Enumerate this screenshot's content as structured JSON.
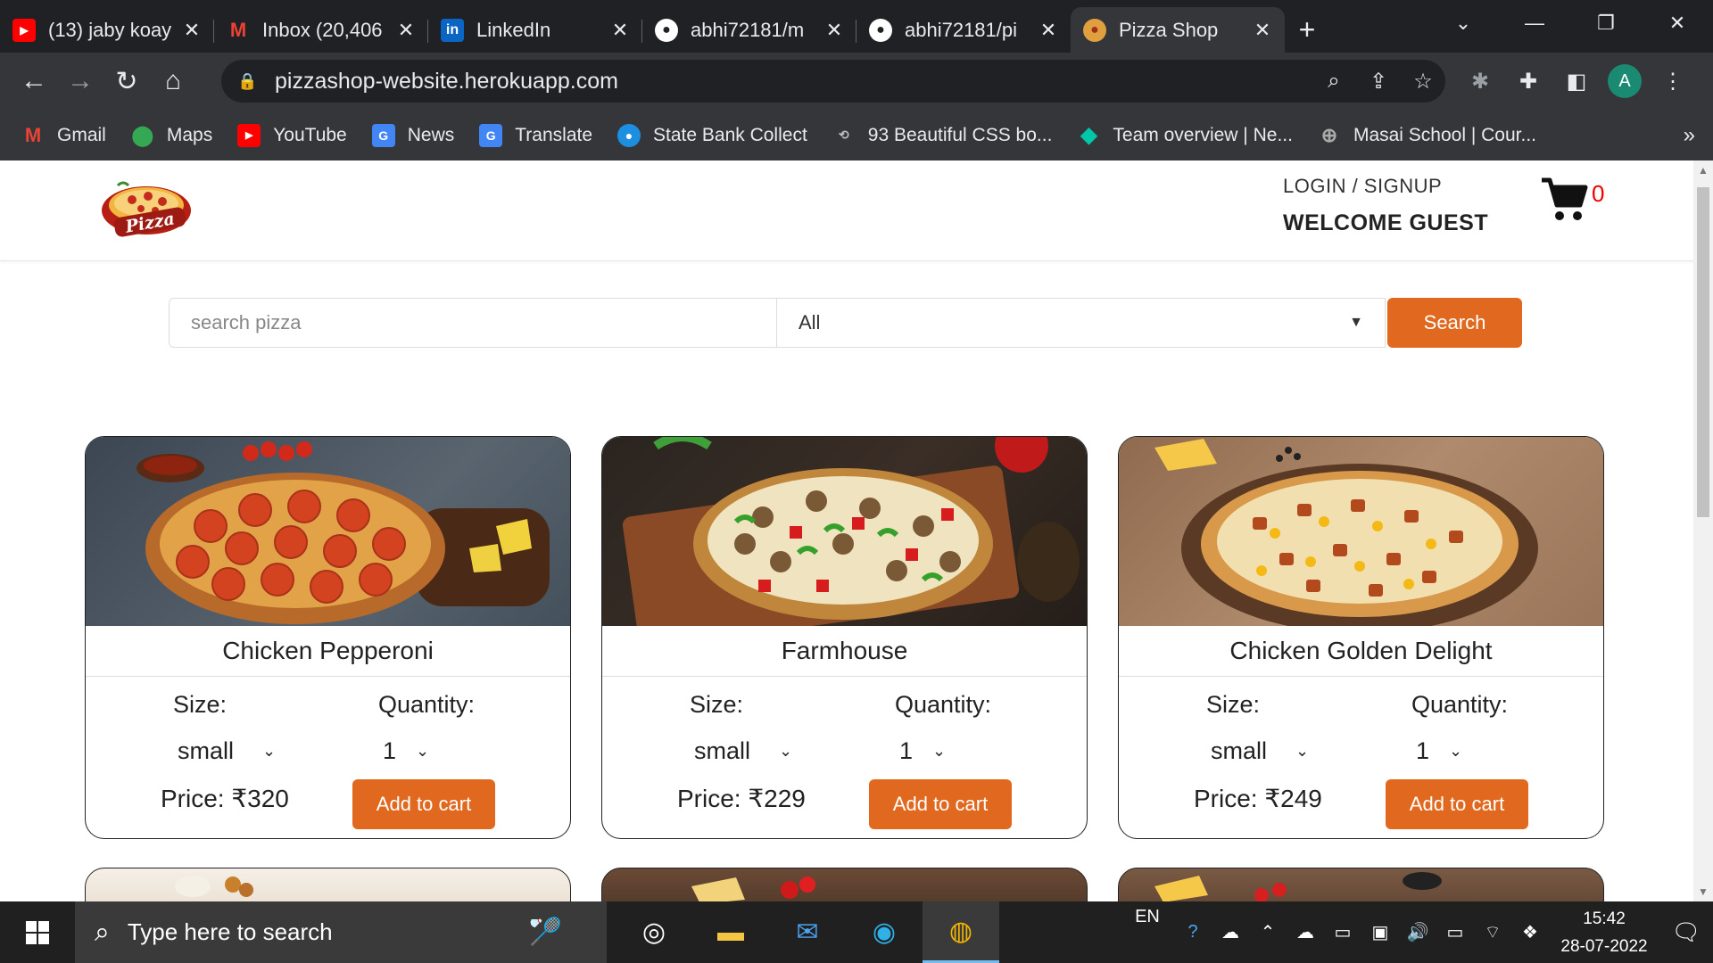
{
  "browser": {
    "tabs": [
      {
        "title": "(13) jaby koay",
        "icon": "youtube-icon",
        "color": "#ff0000"
      },
      {
        "title": "Inbox (20,406",
        "icon": "gmail-icon",
        "color": "#ea4335"
      },
      {
        "title": "LinkedIn",
        "icon": "linkedin-icon",
        "color": "#0a66c2"
      },
      {
        "title": "abhi72181/m",
        "icon": "github-icon",
        "color": "#ffffff"
      },
      {
        "title": "abhi72181/pi",
        "icon": "github-icon",
        "color": "#ffffff"
      },
      {
        "title": "Pizza Shop",
        "icon": "pizza-icon",
        "color": "#e0691f"
      }
    ],
    "url": "pizzashop-website.herokuapp.com",
    "profile_initial": "A",
    "bookmarks": [
      {
        "label": "Gmail",
        "icon": "gmail-icon",
        "color": "#ea4335"
      },
      {
        "label": "Maps",
        "icon": "maps-icon",
        "color": "#34a853"
      },
      {
        "label": "YouTube",
        "icon": "youtube-icon",
        "color": "#ff0000"
      },
      {
        "label": "News",
        "icon": "news-icon",
        "color": "#4285f4"
      },
      {
        "label": "Translate",
        "icon": "translate-icon",
        "color": "#4285f4"
      },
      {
        "label": "State Bank Collect",
        "icon": "sbi-icon",
        "color": "#1d8fe1"
      },
      {
        "label": "93 Beautiful CSS bo...",
        "icon": "css-icon",
        "color": "#555555"
      },
      {
        "label": "Team overview | Ne...",
        "icon": "diamond-icon",
        "color": "#00c7a8"
      },
      {
        "label": "Masai School | Cour...",
        "icon": "globe-icon",
        "color": "#777777"
      }
    ]
  },
  "site": {
    "login_label": "LOGIN / SIGNUP",
    "welcome_label": "WELCOME GUEST",
    "cart_count": "0",
    "logo_text": "Pizza",
    "search": {
      "placeholder": "search pizza",
      "category": "All",
      "button": "Search"
    },
    "accent": "#e0691f",
    "products": [
      {
        "name": "Chicken Pepperoni",
        "size_label": "Size:",
        "size": "small",
        "qty_label": "Quantity:",
        "qty": "1",
        "price": "Price: ₹320",
        "button": "Add to cart"
      },
      {
        "name": "Farmhouse",
        "size_label": "Size:",
        "size": "small",
        "qty_label": "Quantity:",
        "qty": "1",
        "price": "Price: ₹229",
        "button": "Add to cart"
      },
      {
        "name": "Chicken Golden Delight",
        "size_label": "Size:",
        "size": "small",
        "qty_label": "Quantity:",
        "qty": "1",
        "price": "Price: ₹249",
        "button": "Add to cart"
      }
    ]
  },
  "taskbar": {
    "search_placeholder": "Type here to search",
    "lang": "EN",
    "time": "15:42",
    "date": "28-07-2022"
  }
}
